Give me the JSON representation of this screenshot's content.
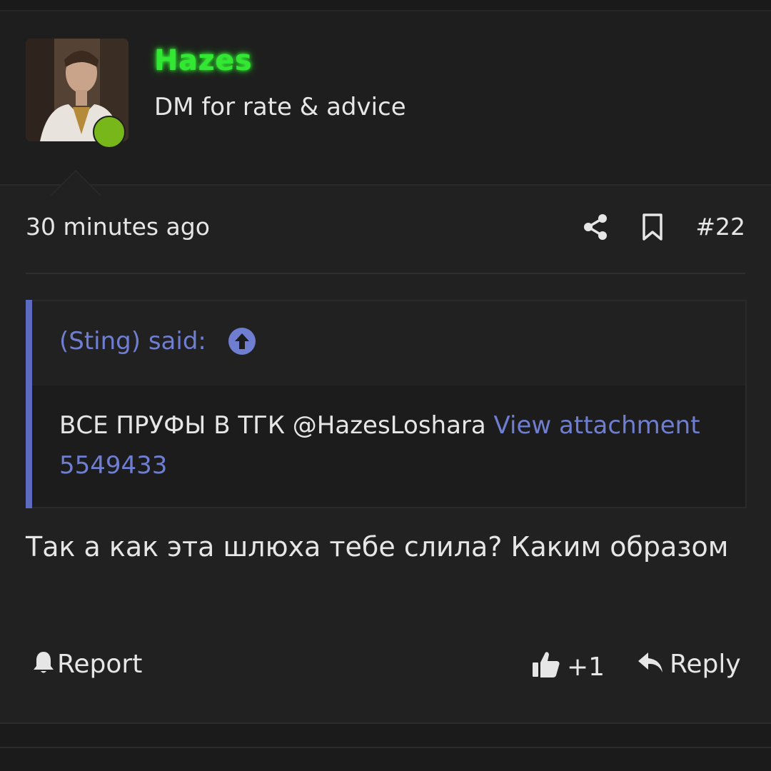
{
  "post": {
    "author": {
      "username": "Hazes",
      "title": "DM for rate & advice",
      "online": true,
      "username_color": "#33e833",
      "online_color": "#77b71a"
    },
    "meta": {
      "timestamp": "30 minutes ago",
      "post_number": "#22",
      "share_icon": "share-icon",
      "bookmark_icon": "bookmark-icon"
    },
    "quote": {
      "author_line": "(Sting) said:",
      "body_text": "ВСЕ ПРУФЫ В ТГК @HazesLoshara ",
      "attachment_link": "View attachment 5549433",
      "accent_color": "#5c6bc0"
    },
    "message": "Так а как эта шлюха тебе слила? Каким образом",
    "actions": {
      "report_label": "Report",
      "like_count": "+1",
      "reply_label": "Reply"
    }
  }
}
